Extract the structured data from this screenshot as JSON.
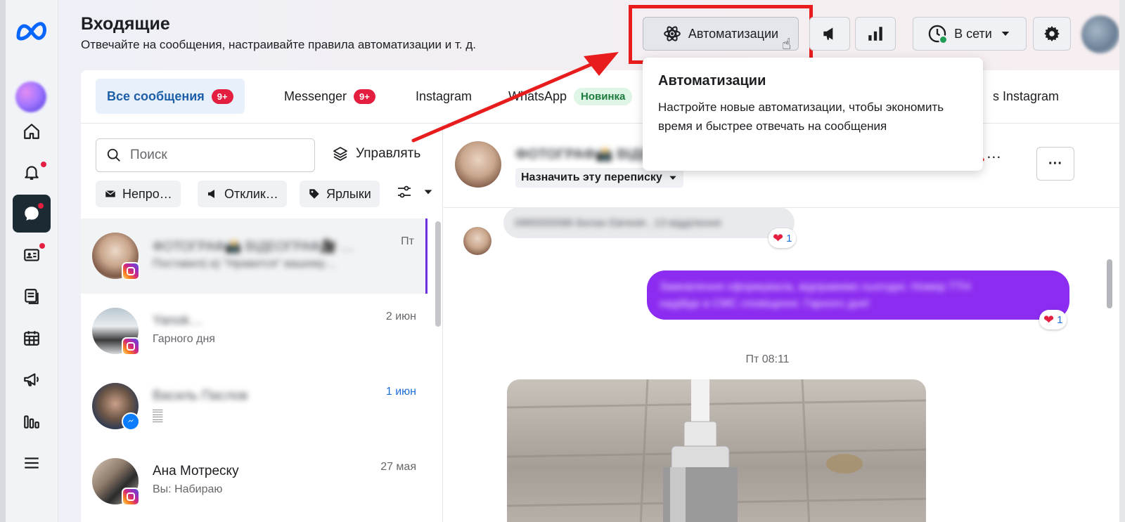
{
  "colors": {
    "accent": "#1d5fa8",
    "highlight": "#e81c1c",
    "outgoing": "#8b2cf0",
    "badge": "#e41e3f",
    "rail_active": "#1c2b33"
  },
  "header": {
    "title": "Входящие",
    "subtitle": "Отвечайте на сообщения, настраивайте правила автоматизации и т. д.",
    "automations_label": "Автоматизации",
    "status_label": "В сети"
  },
  "rail": {
    "icons": [
      "meta-logo-icon",
      "home-icon",
      "bell-icon",
      "chat-icon",
      "contacts-icon",
      "content-icon",
      "calendar-icon",
      "megaphone-icon",
      "insights-icon",
      "menu-icon"
    ]
  },
  "tabs": [
    {
      "label": "Все сообщения",
      "badge": "9+"
    },
    {
      "label": "Messenger",
      "badge": "9+"
    },
    {
      "label": "Instagram"
    },
    {
      "label": "WhatsApp",
      "badge": "Новинка"
    },
    {
      "label": "s Instagram"
    }
  ],
  "list": {
    "search_placeholder": "Поиск",
    "manage_label": "Управлять",
    "chips": [
      "Непро…",
      "Отклик…",
      "Ярлыки"
    ],
    "conversations": [
      {
        "name": "ФОТОГРАФ📸 ВІДЕОГРАФ🎥 …",
        "snippet": "Поставил(-а) \"Нравится\" вашему…",
        "time": "Пт",
        "platform": "instagram",
        "blurred": true
      },
      {
        "name": "Yanok…",
        "snippet": "Гарного дня",
        "time": "2 июн",
        "platform": "instagram",
        "blurred_name": true
      },
      {
        "name": "Василь Паслов",
        "snippet": "𝄛",
        "time": "1 июн",
        "platform": "messenger",
        "blurred_name": true,
        "unread": true
      },
      {
        "name": "Ана Мотреску",
        "snippet": "Вы: Набираю",
        "time": "27 мая",
        "platform": "instagram"
      }
    ]
  },
  "chat": {
    "contact_name": "ФОТОГРАФ📸 ВІДЕОГРАФ",
    "heel": "👠…",
    "assign_label": "Назначить эту переписку",
    "more_label": "···",
    "incoming_text": "0965555586 Белан Евгенія , 13 відділення",
    "incoming_reaction": "1",
    "outgoing_text_1": "Замовлення сформувала, відправимо сьогодні. Номер ТТН",
    "outgoing_text_2": "надійде в СМС сповіщенні. Гарного дня!",
    "outgoing_reaction": "1",
    "date_sep": "Пт 08:11"
  },
  "tooltip": {
    "title": "Автоматизации",
    "body": "Настройте новые автоматизации, чтобы экономить время и быстрее отвечать на сообщения"
  }
}
